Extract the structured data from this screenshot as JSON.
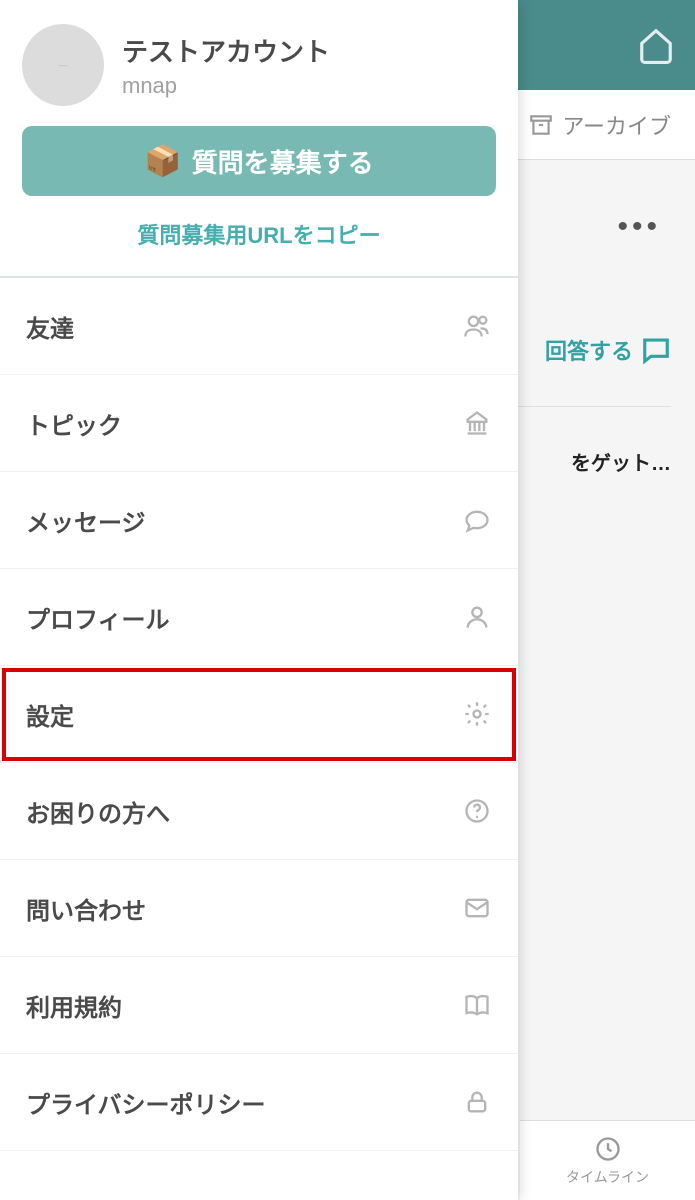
{
  "profile": {
    "name": "テストアカウント",
    "handle": "mnap"
  },
  "recruit_button": "質問を募集する",
  "copy_link": "質問募集用URLをコピー",
  "menu": [
    {
      "label": "友達",
      "icon": "friends-icon",
      "highlight": false
    },
    {
      "label": "トピック",
      "icon": "topic-icon",
      "highlight": false
    },
    {
      "label": "メッセージ",
      "icon": "message-icon",
      "highlight": false
    },
    {
      "label": "プロフィール",
      "icon": "profile-icon",
      "highlight": false
    },
    {
      "label": "設定",
      "icon": "gear-icon",
      "highlight": true
    },
    {
      "label": "お困りの方へ",
      "icon": "help-icon",
      "highlight": false
    },
    {
      "label": "問い合わせ",
      "icon": "mail-icon",
      "highlight": false
    },
    {
      "label": "利用規約",
      "icon": "book-icon",
      "highlight": false
    },
    {
      "label": "プライバシーポリシー",
      "icon": "lock-icon",
      "highlight": false
    }
  ],
  "background": {
    "archive": "アーカイブ",
    "answer": "回答する",
    "snippet": "をゲット…",
    "bottom_tab": "タイムライン"
  }
}
